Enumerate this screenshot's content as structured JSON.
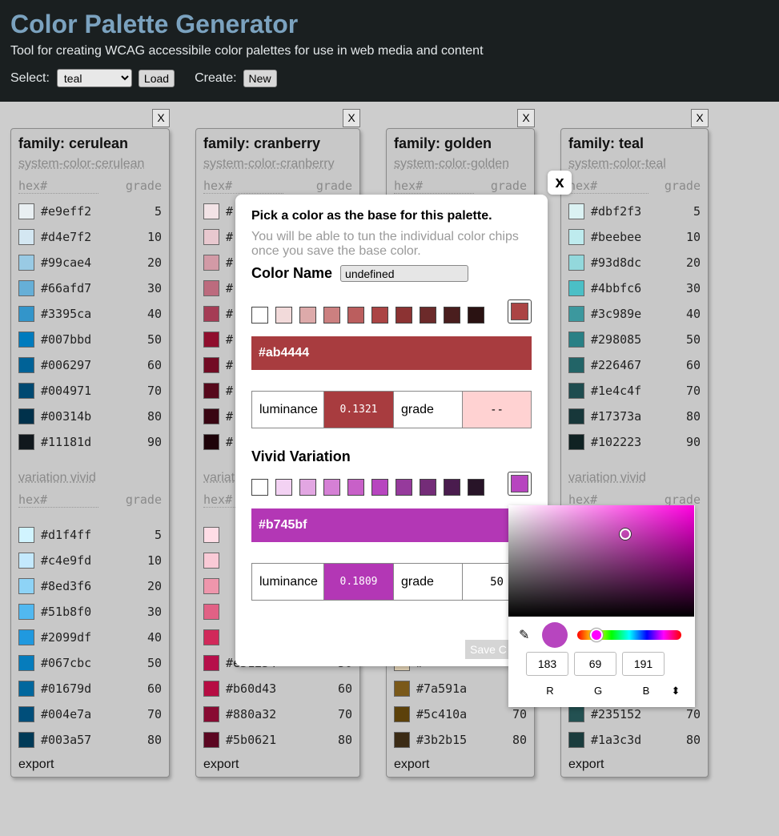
{
  "header": {
    "title": "Color Palette Generator",
    "subtitle": "Tool for creating WCAG accessibile color palettes for use in web media and content",
    "select_label": "Select:",
    "select_value": "teal",
    "load": "Load",
    "create_label": "Create:",
    "new": "New"
  },
  "close": "X",
  "col_hex": "hex#",
  "col_grade": "grade",
  "variation": "variation vivid",
  "export": "export",
  "cards": [
    {
      "family": "family: cerulean",
      "system": "system-color-cerulean",
      "base": [
        [
          "#e9eff2",
          "5",
          "#e9eff2"
        ],
        [
          "#d4e7f2",
          "10",
          "#d4e7f2"
        ],
        [
          "#99cae4",
          "20",
          "#99cae4"
        ],
        [
          "#66afd7",
          "30",
          "#66afd7"
        ],
        [
          "#3395ca",
          "40",
          "#3395ca"
        ],
        [
          "#007bbd",
          "50",
          "#007bbd"
        ],
        [
          "#006297",
          "60",
          "#006297"
        ],
        [
          "#004971",
          "70",
          "#004971"
        ],
        [
          "#00314b",
          "80",
          "#00314b"
        ],
        [
          "#11181d",
          "90",
          "#11181d"
        ]
      ],
      "vivid": [
        [
          "#d1f4ff",
          "5",
          "#d1f4ff"
        ],
        [
          "#c4e9fd",
          "10",
          "#c4e9fd"
        ],
        [
          "#8ed3f6",
          "20",
          "#8ed3f6"
        ],
        [
          "#51b8f0",
          "30",
          "#51b8f0"
        ],
        [
          "#2099df",
          "40",
          "#2099df"
        ],
        [
          "#067cbc",
          "50",
          "#067cbc"
        ],
        [
          "#01679d",
          "60",
          "#01679d"
        ],
        [
          "#004e7a",
          "70",
          "#004e7a"
        ],
        [
          "#003a57",
          "80",
          "#003a57"
        ]
      ]
    },
    {
      "family": "family: cranberry",
      "system": "system-color-cranberry",
      "base": [
        [
          "#",
          "",
          "#f2e3e6"
        ],
        [
          "#",
          "",
          "#e8c8cf"
        ],
        [
          "#",
          "",
          "#d29aa6"
        ],
        [
          "#",
          "",
          "#bc6b7e"
        ],
        [
          "#",
          "",
          "#a53c55"
        ],
        [
          "#",
          "",
          "#8f0e2d"
        ],
        [
          "#",
          "",
          "#720b24"
        ],
        [
          "#",
          "",
          "#56081b"
        ],
        [
          "#",
          "",
          "#390512"
        ],
        [
          "#",
          "",
          "#1e0309"
        ]
      ],
      "vivid": [
        [
          "",
          "",
          "#ffdde6"
        ],
        [
          "",
          "",
          "#f9cad6"
        ],
        [
          "",
          "",
          "#ee96ac"
        ],
        [
          "",
          "",
          "#e16185"
        ],
        [
          "",
          "",
          "#d1295a"
        ],
        [
          "#e31254",
          "50",
          "#b60f4a"
        ],
        [
          "#b60d43",
          "60",
          "#b60d43"
        ],
        [
          "#880a32",
          "70",
          "#880a32"
        ],
        [
          "#5b0621",
          "80",
          "#5b0621"
        ]
      ]
    },
    {
      "family": "family: golden",
      "system": "system-color-golden",
      "base": [],
      "vivid": [
        [
          "#",
          "",
          "#e6d6b8"
        ],
        [
          "#7a591a",
          "60",
          "#7a591a"
        ],
        [
          "#5c410a",
          "70",
          "#5c410a"
        ],
        [
          "#3b2b15",
          "80",
          "#3b2b15"
        ]
      ]
    },
    {
      "family": "family: teal",
      "system": "system-color-teal",
      "base": [
        [
          "#dbf2f3",
          "5",
          "#dbf2f3"
        ],
        [
          "#beebee",
          "10",
          "#beebee"
        ],
        [
          "#93d8dc",
          "20",
          "#93d8dc"
        ],
        [
          "#4bbfc6",
          "30",
          "#4bbfc6"
        ],
        [
          "#3c989e",
          "40",
          "#3c989e"
        ],
        [
          "#298085",
          "50",
          "#298085"
        ],
        [
          "#226467",
          "60",
          "#226467"
        ],
        [
          "#1e4c4f",
          "70",
          "#1e4c4f"
        ],
        [
          "#17373a",
          "80",
          "#17373a"
        ],
        [
          "#102223",
          "90",
          "#102223"
        ]
      ],
      "vivid": [
        [
          "#235152",
          "70",
          "#235152"
        ],
        [
          "#1a3c3d",
          "80",
          "#1a3c3d"
        ]
      ]
    }
  ],
  "modal": {
    "close": "x",
    "heading": "Pick a color as the base for this palette.",
    "sub": "You will be able to tun the individual color chips once you save the base color.",
    "name_label": "Color Name",
    "name_value": "undefined",
    "base_swatches": [
      "#ffffff",
      "#f2dada",
      "#ddaaaa",
      "#cc8080",
      "#bb5e5e",
      "#ab4444",
      "#8c3333",
      "#6c2a2a",
      "#4a1e1e",
      "#2a1212"
    ],
    "base_hex": "#ab4444",
    "base_color": "#a83c3f",
    "lum_label": "luminance",
    "base_lum": "0.1321",
    "grade_label": "grade",
    "base_grade": "--",
    "vivid_title": "Vivid Variation",
    "vivid_swatches": [
      "#ffffff",
      "#f3d2f3",
      "#e2a6e2",
      "#d580d5",
      "#c860c8",
      "#b745bf",
      "#963a9c",
      "#742c78",
      "#4a1c4e",
      "#281428"
    ],
    "vivid_hex": "#b745bf",
    "vivid_color": "#b337b5",
    "vivid_lum": "0.1809",
    "vivid_grade": "50",
    "save": "Save C"
  },
  "picker": {
    "r": "183",
    "g": "69",
    "b": "191",
    "r_l": "R",
    "g_l": "G",
    "b_l": "B",
    "toggle": "⬍",
    "dropper": "✎"
  }
}
